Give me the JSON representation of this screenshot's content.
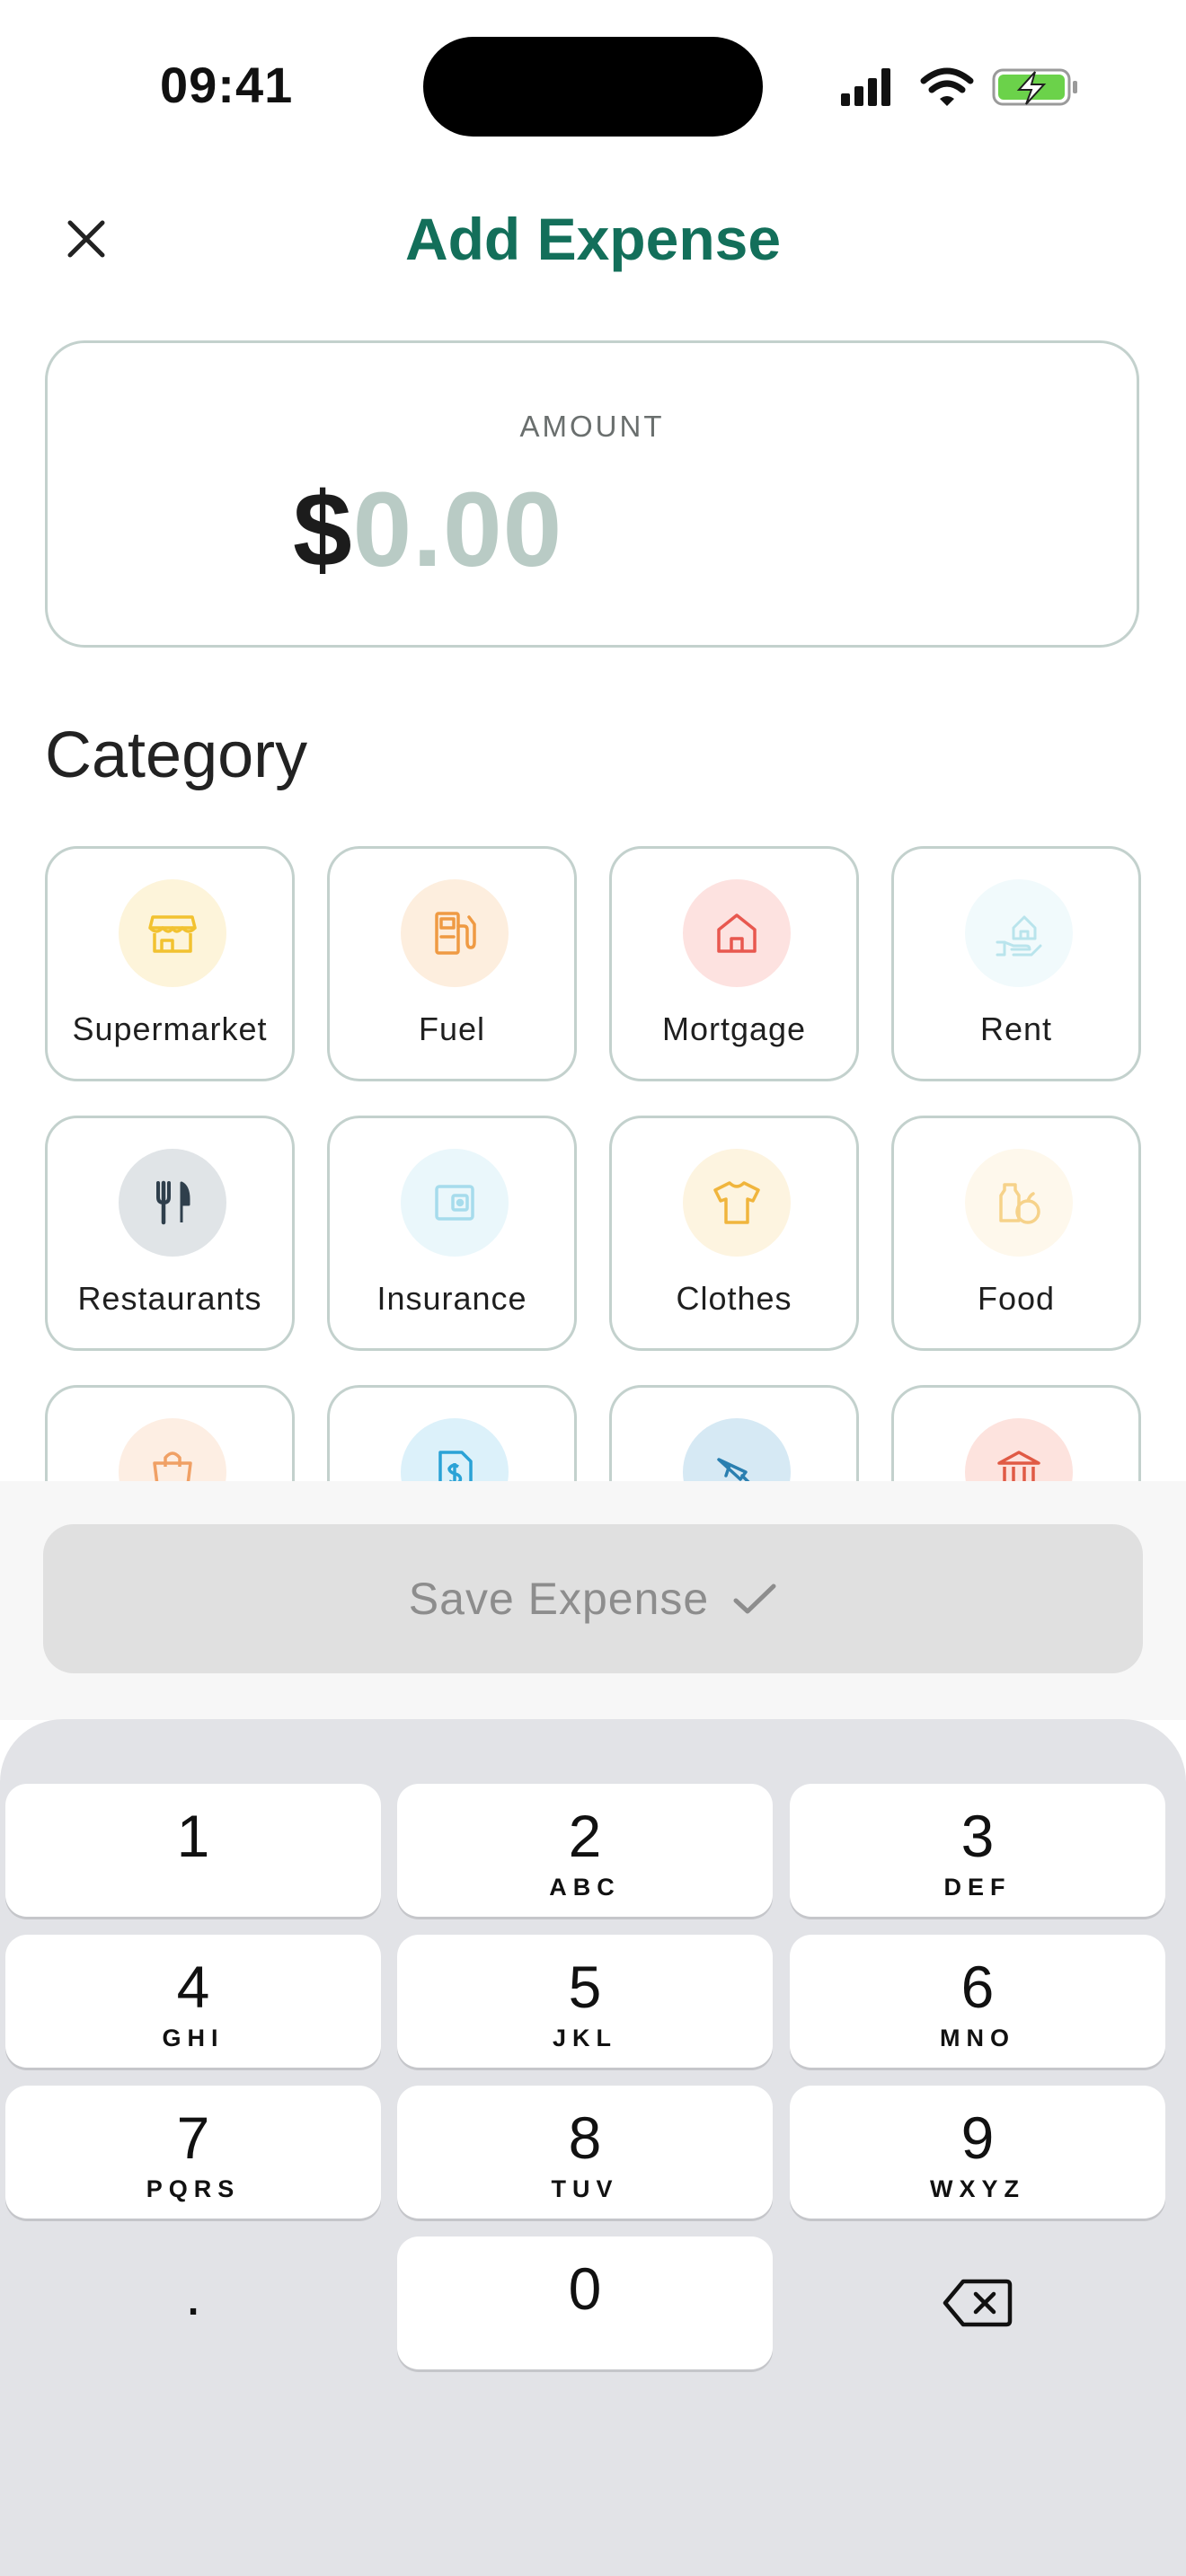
{
  "status_bar": {
    "time": "09:41",
    "icons": [
      "signal-icon",
      "wifi-icon",
      "battery-charging-icon"
    ]
  },
  "header": {
    "title": "Add Expense",
    "close_icon": "close-icon"
  },
  "amount": {
    "label": "AMOUNT",
    "currency": "$",
    "value": "0.00"
  },
  "category": {
    "title": "Category",
    "items": [
      {
        "label": "Supermarket",
        "icon": "store-icon",
        "color": "#f2c230",
        "bg": "#fdf4da"
      },
      {
        "label": "Fuel",
        "icon": "fuel-pump-icon",
        "color": "#ef9a43",
        "bg": "#fdeede"
      },
      {
        "label": "Mortgage",
        "icon": "home-icon",
        "color": "#e8584f",
        "bg": "#fde2e0"
      },
      {
        "label": "Rent",
        "icon": "hand-house-icon",
        "color": "#b9e4ec",
        "bg": "#f1fafc"
      },
      {
        "label": "Restaurants",
        "icon": "fork-knife-icon",
        "color": "#2f3f4c",
        "bg": "#e0e4e7"
      },
      {
        "label": "Insurance",
        "icon": "wallet-icon",
        "color": "#a6dcec",
        "bg": "#eaf7fb"
      },
      {
        "label": "Clothes",
        "icon": "tshirt-icon",
        "color": "#f0b53d",
        "bg": "#fdf4e0"
      },
      {
        "label": "Food",
        "icon": "grocery-icon",
        "color": "#f6d28a",
        "bg": "#fef8ec"
      },
      {
        "label": "",
        "icon": "shopping-bag-icon",
        "color": "#f0a065",
        "bg": "#fdeee3"
      },
      {
        "label": "",
        "icon": "bill-icon",
        "color": "#2aa2d6",
        "bg": "#dcf1fa"
      },
      {
        "label": "",
        "icon": "tool-icon",
        "color": "#2a7fb0",
        "bg": "#d6e9f4"
      },
      {
        "label": "",
        "icon": "bank-icon",
        "color": "#e05a45",
        "bg": "#fde3de"
      }
    ]
  },
  "save_button": {
    "label": "Save Expense",
    "icon": "checkmark-icon",
    "enabled": false
  },
  "keypad": {
    "keys": [
      {
        "digit": "1",
        "letters": ""
      },
      {
        "digit": "2",
        "letters": "ABC"
      },
      {
        "digit": "3",
        "letters": "DEF"
      },
      {
        "digit": "4",
        "letters": "GHI"
      },
      {
        "digit": "5",
        "letters": "JKL"
      },
      {
        "digit": "6",
        "letters": "MNO"
      },
      {
        "digit": "7",
        "letters": "PQRS"
      },
      {
        "digit": "8",
        "letters": "TUV"
      },
      {
        "digit": "9",
        "letters": "WXYZ"
      },
      {
        "digit": "0",
        "letters": ""
      }
    ],
    "decimal": ".",
    "backspace_icon": "backspace-icon"
  }
}
